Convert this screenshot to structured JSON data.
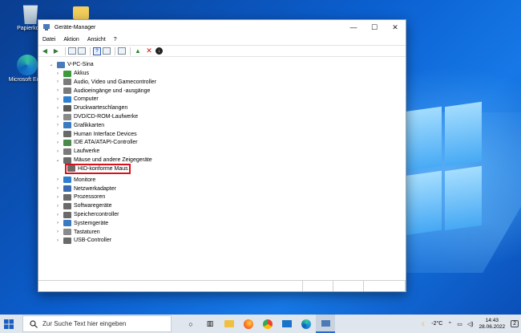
{
  "desktop": {
    "icons": [
      {
        "label": "Papierkorb"
      },
      {
        "label": "Microsoft Edge"
      }
    ]
  },
  "window": {
    "title": "Geräte-Manager",
    "controls": {
      "minimize": "—",
      "maximize": "☐",
      "close": "✕"
    },
    "menu": [
      "Datei",
      "Aktion",
      "Ansicht",
      "?"
    ]
  },
  "tree": {
    "root": "V-PC-Sina",
    "items": [
      {
        "label": "Akkus",
        "icon": "battery-icon",
        "color": "#3c9a3c"
      },
      {
        "label": "Audio, Video und Gamecontroller",
        "icon": "speaker-icon",
        "color": "#7a7a7a"
      },
      {
        "label": "Audioeingänge und -ausgänge",
        "icon": "speaker-icon",
        "color": "#7a7a7a"
      },
      {
        "label": "Computer",
        "icon": "monitor-icon",
        "color": "#2f7fd0"
      },
      {
        "label": "Druckwarteschlangen",
        "icon": "printer-icon",
        "color": "#5a5a5a"
      },
      {
        "label": "DVD/CD-ROM-Laufwerke",
        "icon": "disc-drive-icon",
        "color": "#8a8a8a"
      },
      {
        "label": "Grafikkarten",
        "icon": "display-adapter-icon",
        "color": "#3a7ac0"
      },
      {
        "label": "Human Interface Devices",
        "icon": "hid-icon",
        "color": "#6a6a6a"
      },
      {
        "label": "IDE ATA/ATAPI-Controller",
        "icon": "controller-icon",
        "color": "#4a8a4a"
      },
      {
        "label": "Laufwerke",
        "icon": "drive-icon",
        "color": "#7a7a7a"
      },
      {
        "label": "Mäuse und andere Zeigegeräte",
        "icon": "mouse-icon",
        "color": "#6a6a6a",
        "expanded": true
      },
      {
        "label": "HID-konforme Maus",
        "icon": "mouse-icon",
        "color": "#6a6a6a",
        "child": true
      },
      {
        "label": "Monitore",
        "icon": "monitor-icon",
        "color": "#2f7fd0"
      },
      {
        "label": "Netzwerkadapter",
        "icon": "network-icon",
        "color": "#3a6ab0"
      },
      {
        "label": "Prozessoren",
        "icon": "cpu-icon",
        "color": "#6a6a6a"
      },
      {
        "label": "Softwaregeräte",
        "icon": "software-device-icon",
        "color": "#6a6a6a"
      },
      {
        "label": "Speichercontroller",
        "icon": "storage-controller-icon",
        "color": "#6a6a6a"
      },
      {
        "label": "Systemgeräte",
        "icon": "system-device-icon",
        "color": "#3a7ac0"
      },
      {
        "label": "Tastaturen",
        "icon": "keyboard-icon",
        "color": "#8a8a8a"
      },
      {
        "label": "USB-Controller",
        "icon": "usb-icon",
        "color": "#6a6a6a"
      }
    ]
  },
  "taskbar": {
    "search_placeholder": "Zur Suche Text hier eingeben",
    "weather": "-2°C",
    "time": "14:43",
    "date": "28.06.2022",
    "notifications": "2"
  },
  "colors": {
    "highlight": "#d8121b",
    "desktop": "#0b5fcf"
  }
}
